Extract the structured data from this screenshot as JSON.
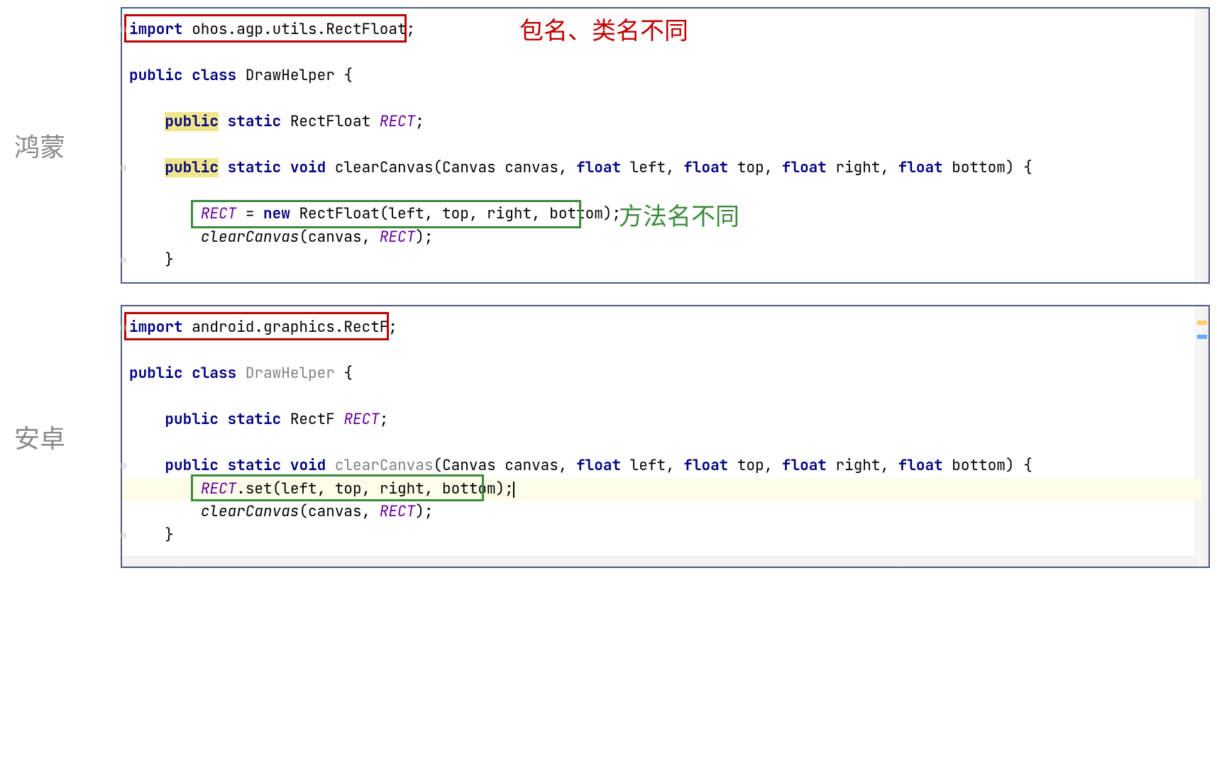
{
  "labels": {
    "harmony": "鸿蒙",
    "android": "安卓"
  },
  "annotations": {
    "package_diff": "包名、类名不同",
    "method_diff": "方法名不同"
  },
  "harmony": {
    "import_kw": "import",
    "import_pkg": " ohos.agp.utils.RectFloat;",
    "class_kw_public": "public",
    "class_kw_class": "class",
    "class_name": " DrawHelper {",
    "field_kw_public": "public",
    "field_kw_static": "static",
    "field_type": " RectFloat ",
    "field_name": "RECT",
    "field_semi": ";",
    "method_kw_public": "public",
    "method_kw_static": "static",
    "method_kw_void": "void",
    "method_sig_1": " clearCanvas(Canvas canvas, ",
    "method_kw_float1": "float",
    "method_sig_2": " left, ",
    "method_kw_float2": "float",
    "method_sig_3": " top, ",
    "method_kw_float3": "float",
    "method_sig_4": " right, ",
    "method_kw_float4": "float",
    "method_sig_5": " bottom) {",
    "body1_var": "RECT",
    "body1_eq": " = ",
    "body1_new": "new",
    "body1_ctor": " RectFloat(left, top, right, bottom);",
    "body2_call": "clearCanvas",
    "body2_args_1": "(canvas, ",
    "body2_args_var": "RECT",
    "body2_args_2": ");",
    "close_brace": "}"
  },
  "android": {
    "import_kw": "import",
    "import_pkg": " android.graphics.RectF;",
    "class_kw_public": "public",
    "class_kw_class": "class",
    "class_name_pre": " ",
    "class_name_gray": "DrawHelper",
    "class_name_post": " {",
    "field_kw_public": "public",
    "field_kw_static": "static",
    "field_type": " RectF ",
    "field_name": "RECT",
    "field_semi": ";",
    "method_kw_public": "public",
    "method_kw_static": "static",
    "method_kw_void": "void",
    "method_name_gray": "clearCanvas",
    "method_sig_1": "(Canvas canvas, ",
    "method_kw_float1": "float",
    "method_sig_2": " left, ",
    "method_kw_float2": "float",
    "method_sig_3": " top, ",
    "method_kw_float3": "float",
    "method_sig_4": " right, ",
    "method_kw_float4": "float",
    "method_sig_5": " bottom) {",
    "body1_var": "RECT",
    "body1_rest": ".set(left, top, right, bottom);",
    "body2_call": "clearCanvas",
    "body2_args_1": "(canvas, ",
    "body2_args_var": "RECT",
    "body2_args_2": ");",
    "close_brace": "}"
  }
}
